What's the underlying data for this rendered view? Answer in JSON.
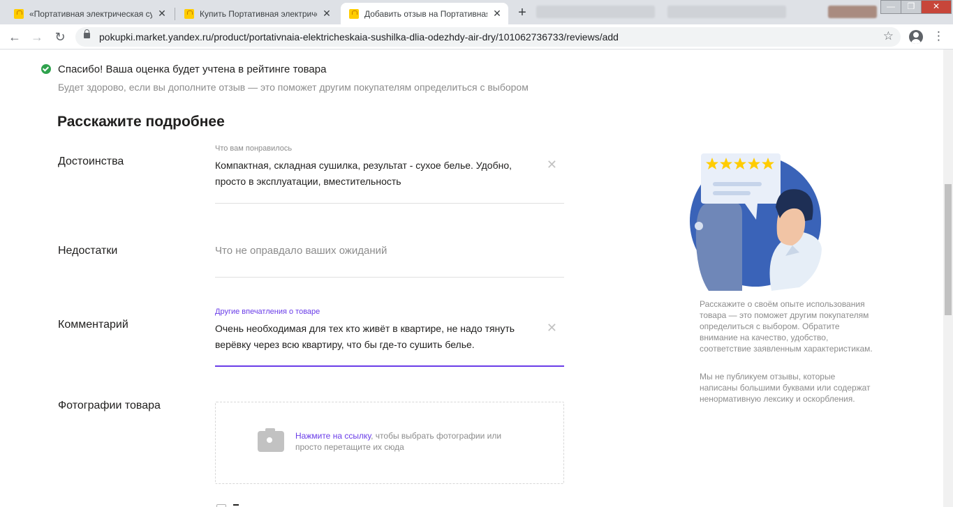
{
  "browser": {
    "tabs": [
      {
        "title": "«Портативная электрическая сушилка",
        "active": false
      },
      {
        "title": "Купить Портативная электрическая",
        "active": false
      },
      {
        "title": "Добавить отзыв на Портативная",
        "active": true
      }
    ],
    "new_tab_symbol": "+",
    "close_symbol": "✕",
    "url": "pokupki.market.yandex.ru/product/portativnaia-elektricheskaia-sushilka-dlia-odezhdy-air-dry/101062736733/reviews/add",
    "icons": {
      "back": "←",
      "forward": "→",
      "reload": "↻",
      "star": "☆",
      "menu": "⋮",
      "minimize": "—",
      "restore": "❐",
      "close": "✕"
    },
    "accent": "#dee1e6"
  },
  "confirmation": {
    "title": "Спасибо! Ваша оценка будет учтена в рейтинге товара",
    "subtitle": "Будет здорово, если вы дополните отзыв — это поможет другим покупателям определиться с выбором",
    "icon": "check-circle-icon",
    "color": "#2fa24d"
  },
  "form": {
    "heading": "Расскажите подробнее",
    "advantages": {
      "label": "Достоинства",
      "hint": "Что вам понравилось",
      "value": "Компактная, складная сушилка, результат - сухое белье. Удобно, просто в эксплуатации, вместительность",
      "clear": "✕"
    },
    "disadvantages": {
      "label": "Недостатки",
      "placeholder": "Что не оправдало ваших ожиданий"
    },
    "comment": {
      "label": "Комментарий",
      "hint": "Другие впечатления о товаре",
      "value": "Очень необходимая для тех кто живёт в квартире, не надо тянуть верёвку через всю квартиру, что бы где-то сушить белье.",
      "clear": "✕",
      "focus_color": "#6a3de8"
    },
    "photos": {
      "label": "Фотографии товара",
      "link_text": "Нажмите на ссылку",
      "rest_text": ", чтобы выбрать фотографии или просто перетащите их сюда",
      "icon": "camera-icon"
    }
  },
  "sidebar": {
    "illustration_rating_stars": 5,
    "tip1": "Расскажите о своём опыте использования товара — это поможет другим покупателям определиться с выбором. Обратите внимание на качество, удобство, соответствие заявленным характеристикам.",
    "tip2": "Мы не публикуем отзывы, которые написаны большими буквами или содержат ненормативную лексику и оскорбления."
  }
}
